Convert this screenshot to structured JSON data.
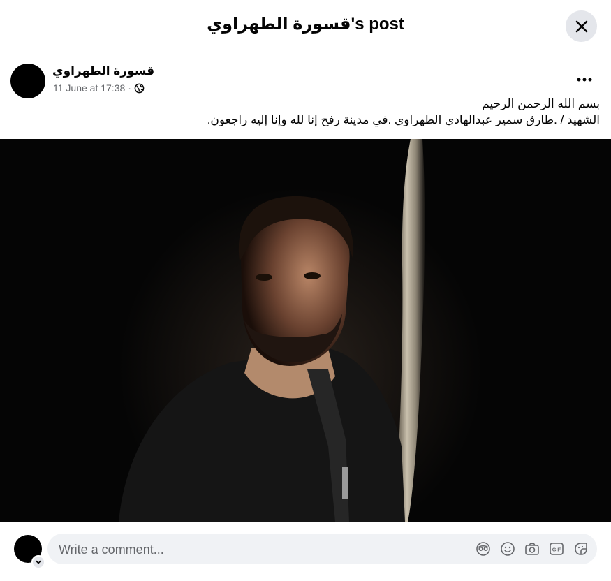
{
  "header": {
    "title": "قسورة الطهراوي's post",
    "close_icon": "close-icon"
  },
  "post": {
    "author": "قسورة الطهراوي",
    "timestamp": "11 June at 17:38",
    "separator": "·",
    "privacy_icon": "globe-icon",
    "more_icon": "more-horizontal-icon",
    "text_lines": [
      "بسم الله الرحمن الرحيم",
      "الشهيد / .طارق سمير عبدالهادي الطهراوي .في مدينة رفح إنا لله وإنا إليه راجعون."
    ]
  },
  "comment": {
    "placeholder": "Write a comment...",
    "icons": [
      "avatar-sticker-icon",
      "emoji-icon",
      "camera-icon",
      "gif-icon",
      "sticker-icon"
    ]
  },
  "colors": {
    "header_border": "#dddfe2",
    "close_bg": "#e4e6eb",
    "meta_text": "#65676b",
    "input_bg": "#f0f2f5"
  }
}
